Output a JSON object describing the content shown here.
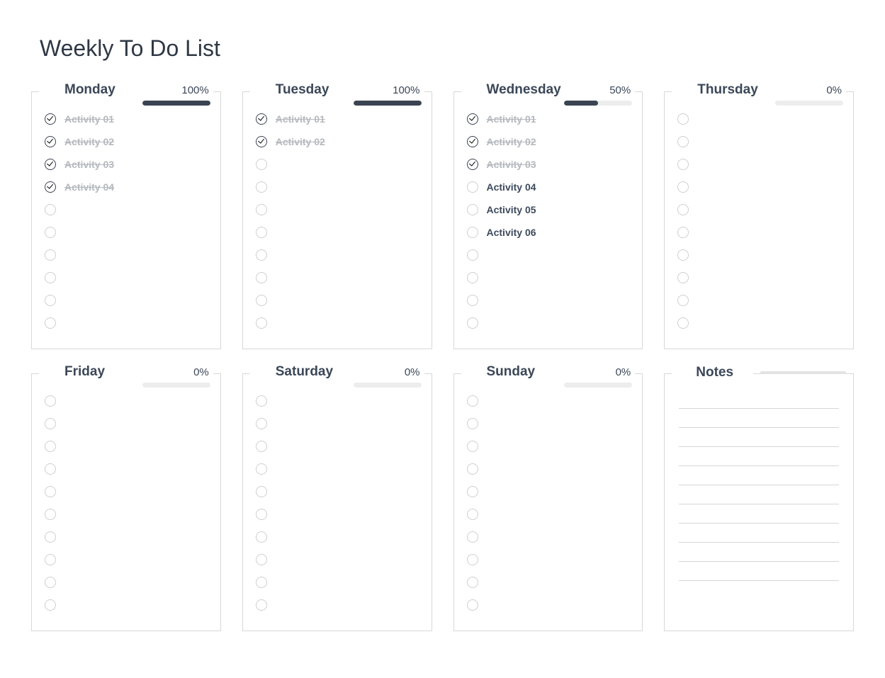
{
  "title": "Weekly To Do List",
  "days": [
    {
      "name": "Monday",
      "percent": "100%",
      "progress": 100,
      "tasks": [
        {
          "label": "Activity 01",
          "done": true
        },
        {
          "label": "Activity 02",
          "done": true
        },
        {
          "label": "Activity 03",
          "done": true
        },
        {
          "label": "Activity 04",
          "done": true
        }
      ],
      "slots": 10
    },
    {
      "name": "Tuesday",
      "percent": "100%",
      "progress": 100,
      "tasks": [
        {
          "label": "Activity 01",
          "done": true
        },
        {
          "label": "Activity 02",
          "done": true
        }
      ],
      "slots": 10
    },
    {
      "name": "Wednesday",
      "percent": "50%",
      "progress": 50,
      "tasks": [
        {
          "label": "Activity 01",
          "done": true
        },
        {
          "label": "Activity 02",
          "done": true
        },
        {
          "label": "Activity 03",
          "done": true
        },
        {
          "label": "Activity 04",
          "done": false
        },
        {
          "label": "Activity 05",
          "done": false
        },
        {
          "label": "Activity 06",
          "done": false
        }
      ],
      "slots": 10
    },
    {
      "name": "Thursday",
      "percent": "0%",
      "progress": 0,
      "tasks": [],
      "slots": 10
    },
    {
      "name": "Friday",
      "percent": "0%",
      "progress": 0,
      "tasks": [],
      "slots": 10
    },
    {
      "name": "Saturday",
      "percent": "0%",
      "progress": 0,
      "tasks": [],
      "slots": 10
    },
    {
      "name": "Sunday",
      "percent": "0%",
      "progress": 0,
      "tasks": [],
      "slots": 10
    }
  ],
  "notes": {
    "title": "Notes",
    "lines": 10
  }
}
